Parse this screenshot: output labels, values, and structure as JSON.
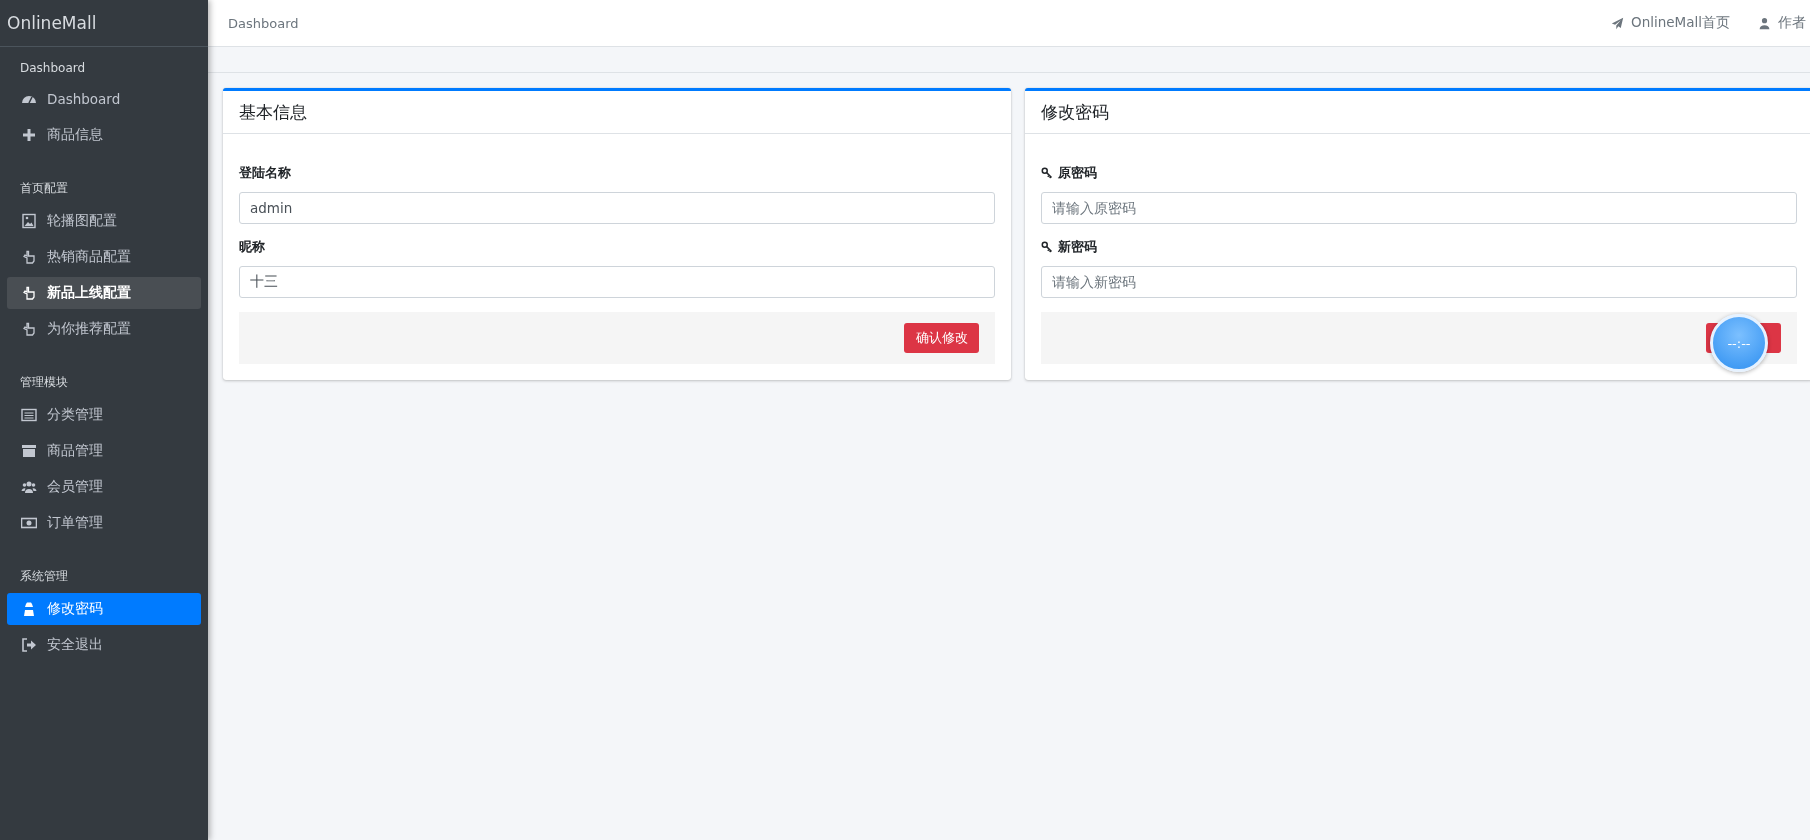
{
  "sidebar": {
    "brand": "OnlineMall",
    "sections": [
      {
        "title": "Dashboard",
        "items": [
          {
            "label": "Dashboard",
            "selected": false,
            "hovered": false
          },
          {
            "label": "商品信息",
            "selected": false,
            "hovered": false
          }
        ]
      },
      {
        "title": "首页配置",
        "items": [
          {
            "label": "轮播图配置",
            "selected": false,
            "hovered": false
          },
          {
            "label": "热销商品配置",
            "selected": false,
            "hovered": false
          },
          {
            "label": "新品上线配置",
            "selected": false,
            "hovered": true
          },
          {
            "label": "为你推荐配置",
            "selected": false,
            "hovered": false
          }
        ]
      },
      {
        "title": "管理模块",
        "items": [
          {
            "label": "分类管理",
            "selected": false,
            "hovered": false
          },
          {
            "label": "商品管理",
            "selected": false,
            "hovered": false
          },
          {
            "label": "会员管理",
            "selected": false,
            "hovered": false
          },
          {
            "label": "订单管理",
            "selected": false,
            "hovered": false
          }
        ]
      },
      {
        "title": "系统管理",
        "items": [
          {
            "label": "修改密码",
            "selected": true,
            "hovered": false
          },
          {
            "label": "安全退出",
            "selected": false,
            "hovered": false
          }
        ]
      }
    ]
  },
  "topbar": {
    "breadcrumb": "Dashboard",
    "links": [
      "OnlineMall首页",
      "作者"
    ]
  },
  "cards": [
    {
      "title": "基本信息",
      "fields": [
        {
          "label": "登陆名称",
          "value": "admin",
          "key_icon": false
        },
        {
          "label": "昵称",
          "value": "十三",
          "key_icon": false
        }
      ],
      "button": "确认修改"
    },
    {
      "title": "修改密码",
      "fields": [
        {
          "label": "原密码",
          "placeholder": "请输入原密码",
          "key_icon": true
        },
        {
          "label": "新密码",
          "placeholder": "请输入新密码",
          "key_icon": true
        }
      ]
    }
  ],
  "timer_widget": {
    "text": "--:--"
  }
}
